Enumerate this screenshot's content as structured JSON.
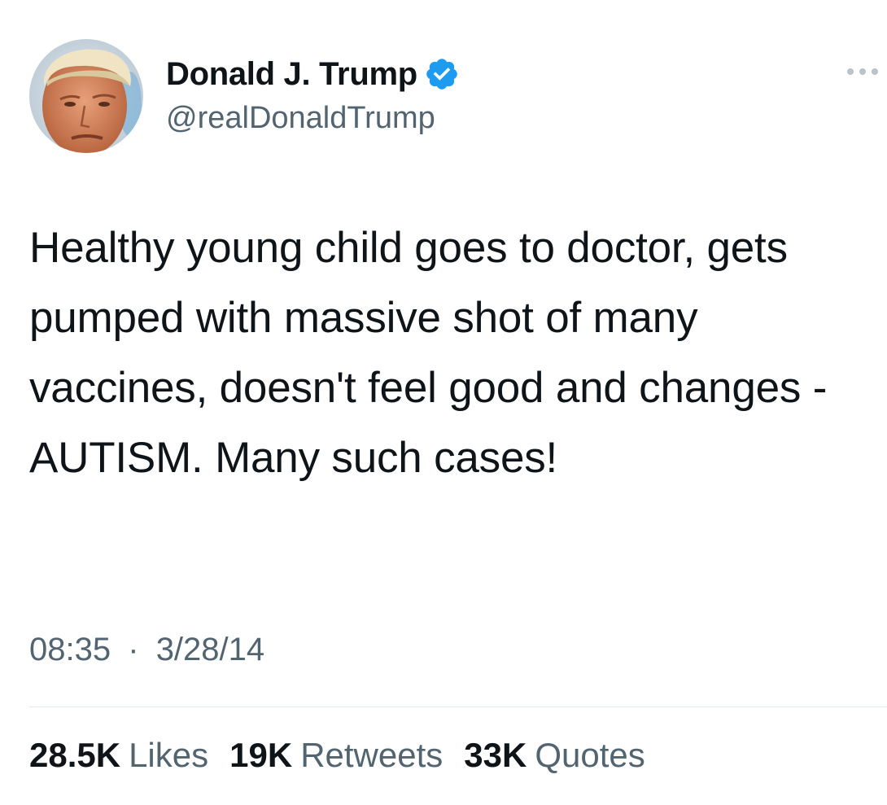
{
  "author": {
    "display_name": "Donald J. Trump",
    "handle": "@realDonaldTrump",
    "verified": true,
    "avatar_icon": "profile-photo"
  },
  "menu_icon": "more-options-icon",
  "tweet": {
    "text": "Healthy young child goes to doctor, gets pumped with massive shot of many vaccines, doesn't feel good and changes - AUTISM. Many such cases!",
    "time": "08:35",
    "separator": "·",
    "date": "3/28/14"
  },
  "stats": [
    {
      "value": "28.5K",
      "label": "Likes"
    },
    {
      "value": "19K",
      "label": "Retweets"
    },
    {
      "value": "33K",
      "label": "Quotes"
    }
  ],
  "colors": {
    "verified_badge": "#1d9bf0",
    "secondary_text": "#536471",
    "primary_text": "#0f1419",
    "divider": "#e1e8ed"
  }
}
